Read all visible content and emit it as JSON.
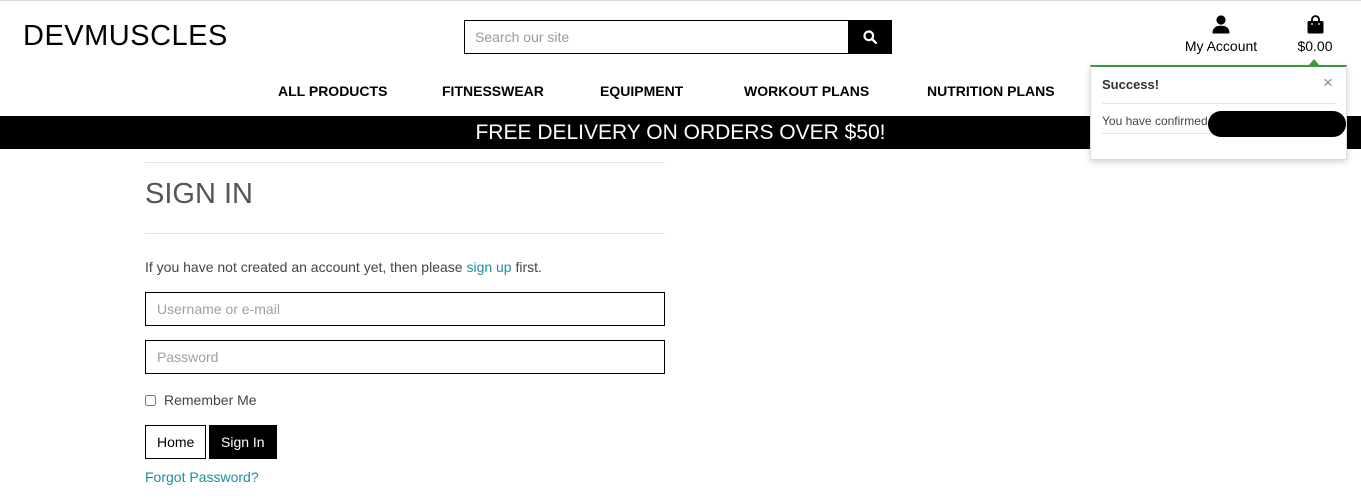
{
  "header": {
    "logo": "DEVMUSCLES",
    "search_placeholder": "Search our site",
    "account_label": "My Account",
    "cart_total": "$0.00"
  },
  "nav": {
    "items": [
      "ALL PRODUCTS",
      "FITNESSWEAR",
      "EQUIPMENT",
      "WORKOUT PLANS",
      "NUTRITION PLANS"
    ]
  },
  "banner": {
    "text": "FREE DELIVERY ON ORDERS OVER $50!"
  },
  "signin": {
    "title": "SIGN IN",
    "intro_before": "If you have not created an account yet, then please ",
    "intro_link": "sign up",
    "intro_after": " first.",
    "username_placeholder": "Username or e-mail",
    "password_placeholder": "Password",
    "remember_label": "Remember Me",
    "home_button": "Home",
    "signin_button": "Sign In",
    "forgot_link": "Forgot Password?"
  },
  "toast": {
    "title": "Success!",
    "close": "×",
    "message": "You have confirmed"
  },
  "colors": {
    "link": "#1b8fa0",
    "toast_accent": "#3a9a43",
    "banner_bg": "#000000"
  },
  "icons": [
    "search-icon",
    "user-icon",
    "shopping-bag-icon",
    "close-icon"
  ]
}
